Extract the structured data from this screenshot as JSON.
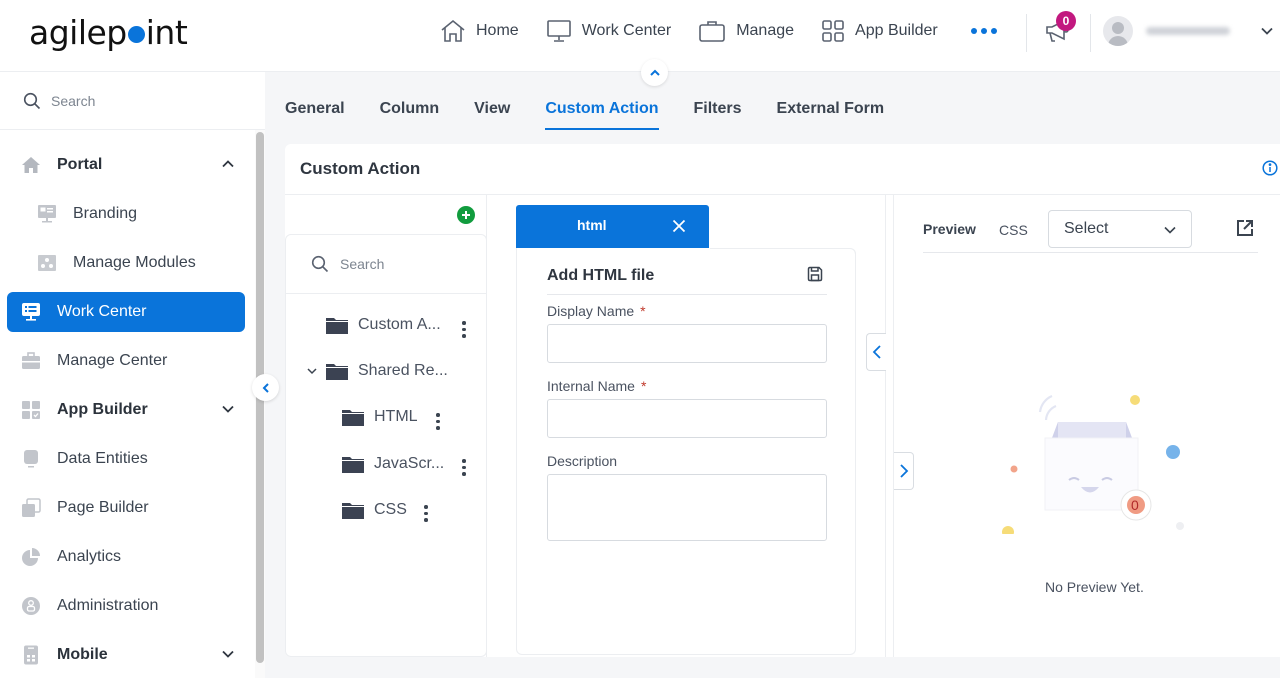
{
  "header": {
    "logo_text_before": "agilep",
    "logo_text_after": "int",
    "nav": [
      {
        "label": "Home",
        "icon": "home-icon"
      },
      {
        "label": "Work Center",
        "icon": "monitor-icon"
      },
      {
        "label": "Manage",
        "icon": "briefcase-icon"
      },
      {
        "label": "App Builder",
        "icon": "grid-icon"
      }
    ],
    "more_icon": "more-horizontal-icon",
    "notifications_count": "0",
    "user_name": "(blurred)"
  },
  "sidebar": {
    "search_placeholder": "Search",
    "items": [
      {
        "label": "Portal",
        "icon": "home-icon",
        "expanded": true
      },
      {
        "label": "Branding",
        "icon": "branding-icon",
        "sub": true
      },
      {
        "label": "Manage Modules",
        "icon": "modules-icon",
        "sub": true
      },
      {
        "label": "Work Center",
        "icon": "work-center-icon",
        "active": true
      },
      {
        "label": "Manage Center",
        "icon": "toolbox-icon"
      },
      {
        "label": "App Builder",
        "icon": "app-builder-icon",
        "expanded": false
      },
      {
        "label": "Data Entities",
        "icon": "data-entities-icon"
      },
      {
        "label": "Page Builder",
        "icon": "page-builder-icon"
      },
      {
        "label": "Analytics",
        "icon": "pie-chart-icon"
      },
      {
        "label": "Administration",
        "icon": "admin-icon"
      },
      {
        "label": "Mobile",
        "icon": "mobile-icon",
        "expanded": false
      }
    ]
  },
  "tabs": [
    {
      "label": "General"
    },
    {
      "label": "Column"
    },
    {
      "label": "View"
    },
    {
      "label": "Custom Action",
      "active": true
    },
    {
      "label": "Filters"
    },
    {
      "label": "External Form"
    }
  ],
  "panel": {
    "title": "Custom Action",
    "tree": {
      "search_placeholder": "Search",
      "nodes": [
        {
          "label": "Custom A...",
          "level": 0
        },
        {
          "label": "Shared Re...",
          "level": 0,
          "expanded": true
        },
        {
          "label": "HTML",
          "level": 1
        },
        {
          "label": "JavaScr...",
          "level": 1
        },
        {
          "label": "CSS",
          "level": 1
        }
      ]
    },
    "editor": {
      "tab_label": "html",
      "form_title": "Add HTML file",
      "fields": {
        "display_name": {
          "label": "Display Name",
          "required": "*",
          "value": ""
        },
        "internal_name": {
          "label": "Internal Name",
          "required": "*",
          "value": ""
        },
        "description": {
          "label": "Description",
          "value": ""
        }
      }
    },
    "preview": {
      "label": "Preview",
      "css_label": "CSS",
      "css_select_value": "Select",
      "empty_text": "No Preview Yet.",
      "empty_badge": "0"
    }
  },
  "colors": {
    "accent": "#0a74da",
    "badge": "#c2187f",
    "add": "#119c3e",
    "required": "#c0392b"
  }
}
